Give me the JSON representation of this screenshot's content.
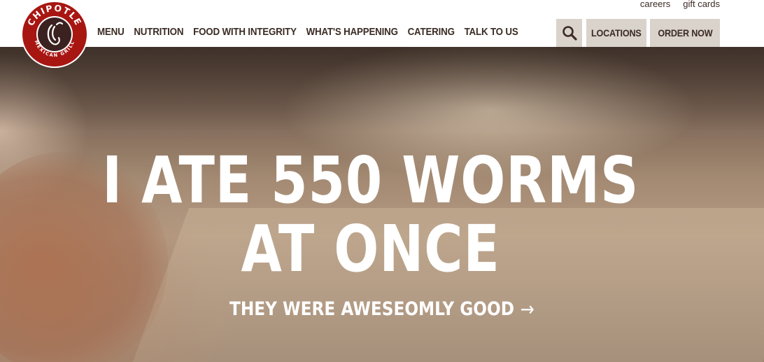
{
  "utility_links": {
    "careers": "careers",
    "gift_cards": "gift cards"
  },
  "logo": {
    "text_top": "CHIPOTLE",
    "text_bottom": "MEXICAN GRILL",
    "color": "#a81612"
  },
  "nav": {
    "items": [
      {
        "label": "MENU"
      },
      {
        "label": "NUTRITION"
      },
      {
        "label": "FOOD WITH INTEGRITY"
      },
      {
        "label": "WHAT'S HAPPENING"
      },
      {
        "label": "CATERING"
      },
      {
        "label": "TALK TO US"
      }
    ],
    "search_icon": "search-icon",
    "locations_label": "LOCATIONS",
    "order_label": "ORDER NOW"
  },
  "hero": {
    "title_line1": "I ATE 550 WORMS",
    "title_line2": "AT ONCE",
    "subtitle": "THEY WERE AWESEOMLY GOOD",
    "arrow_icon": "arrow-right-icon"
  },
  "colors": {
    "brand_red": "#a81612",
    "text_dark": "#3b2b24",
    "button_bg": "#d9d3cc"
  }
}
